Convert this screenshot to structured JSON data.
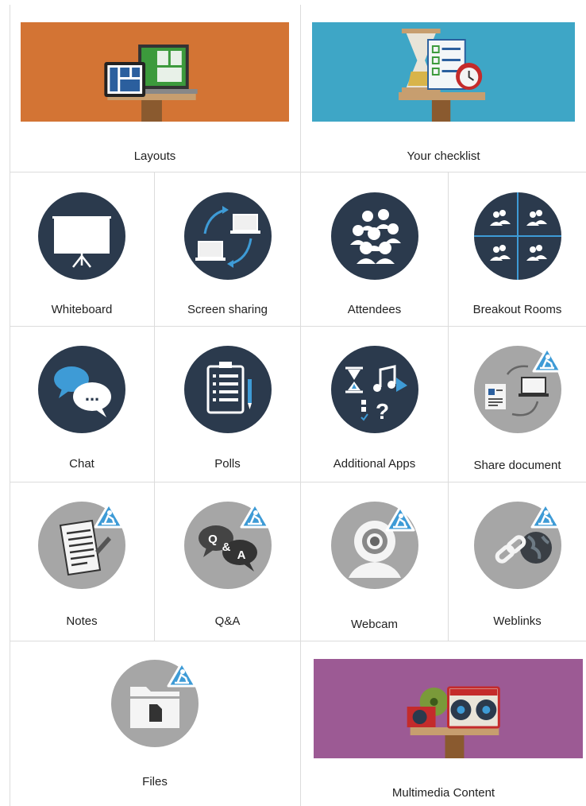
{
  "tiles": {
    "layouts": "Layouts",
    "checklist": "Your checklist",
    "whiteboard": "Whiteboard",
    "screen_sharing": "Screen sharing",
    "attendees": "Attendees",
    "breakout_rooms": "Breakout Rooms",
    "chat": "Chat",
    "polls": "Polls",
    "additional_apps": "Additional Apps",
    "share_document": "Share document",
    "notes": "Notes",
    "qa": "Q&A",
    "webcam": "Webcam",
    "weblinks": "Weblinks",
    "files": "Files",
    "multimedia": "Multimedia Content"
  },
  "icons": {
    "qa_q": "Q",
    "qa_amp": "&",
    "qa_a": "A",
    "chat_dots": "...",
    "apps_q": "?"
  },
  "colors": {
    "dark_circle": "#2b3a4d",
    "grey_circle": "#a6a6a6",
    "badge_blue": "#3e9bd6",
    "layouts_bg": "#d37434",
    "checklist_bg": "#3ea6c6",
    "multimedia_bg": "#9c5a94"
  }
}
